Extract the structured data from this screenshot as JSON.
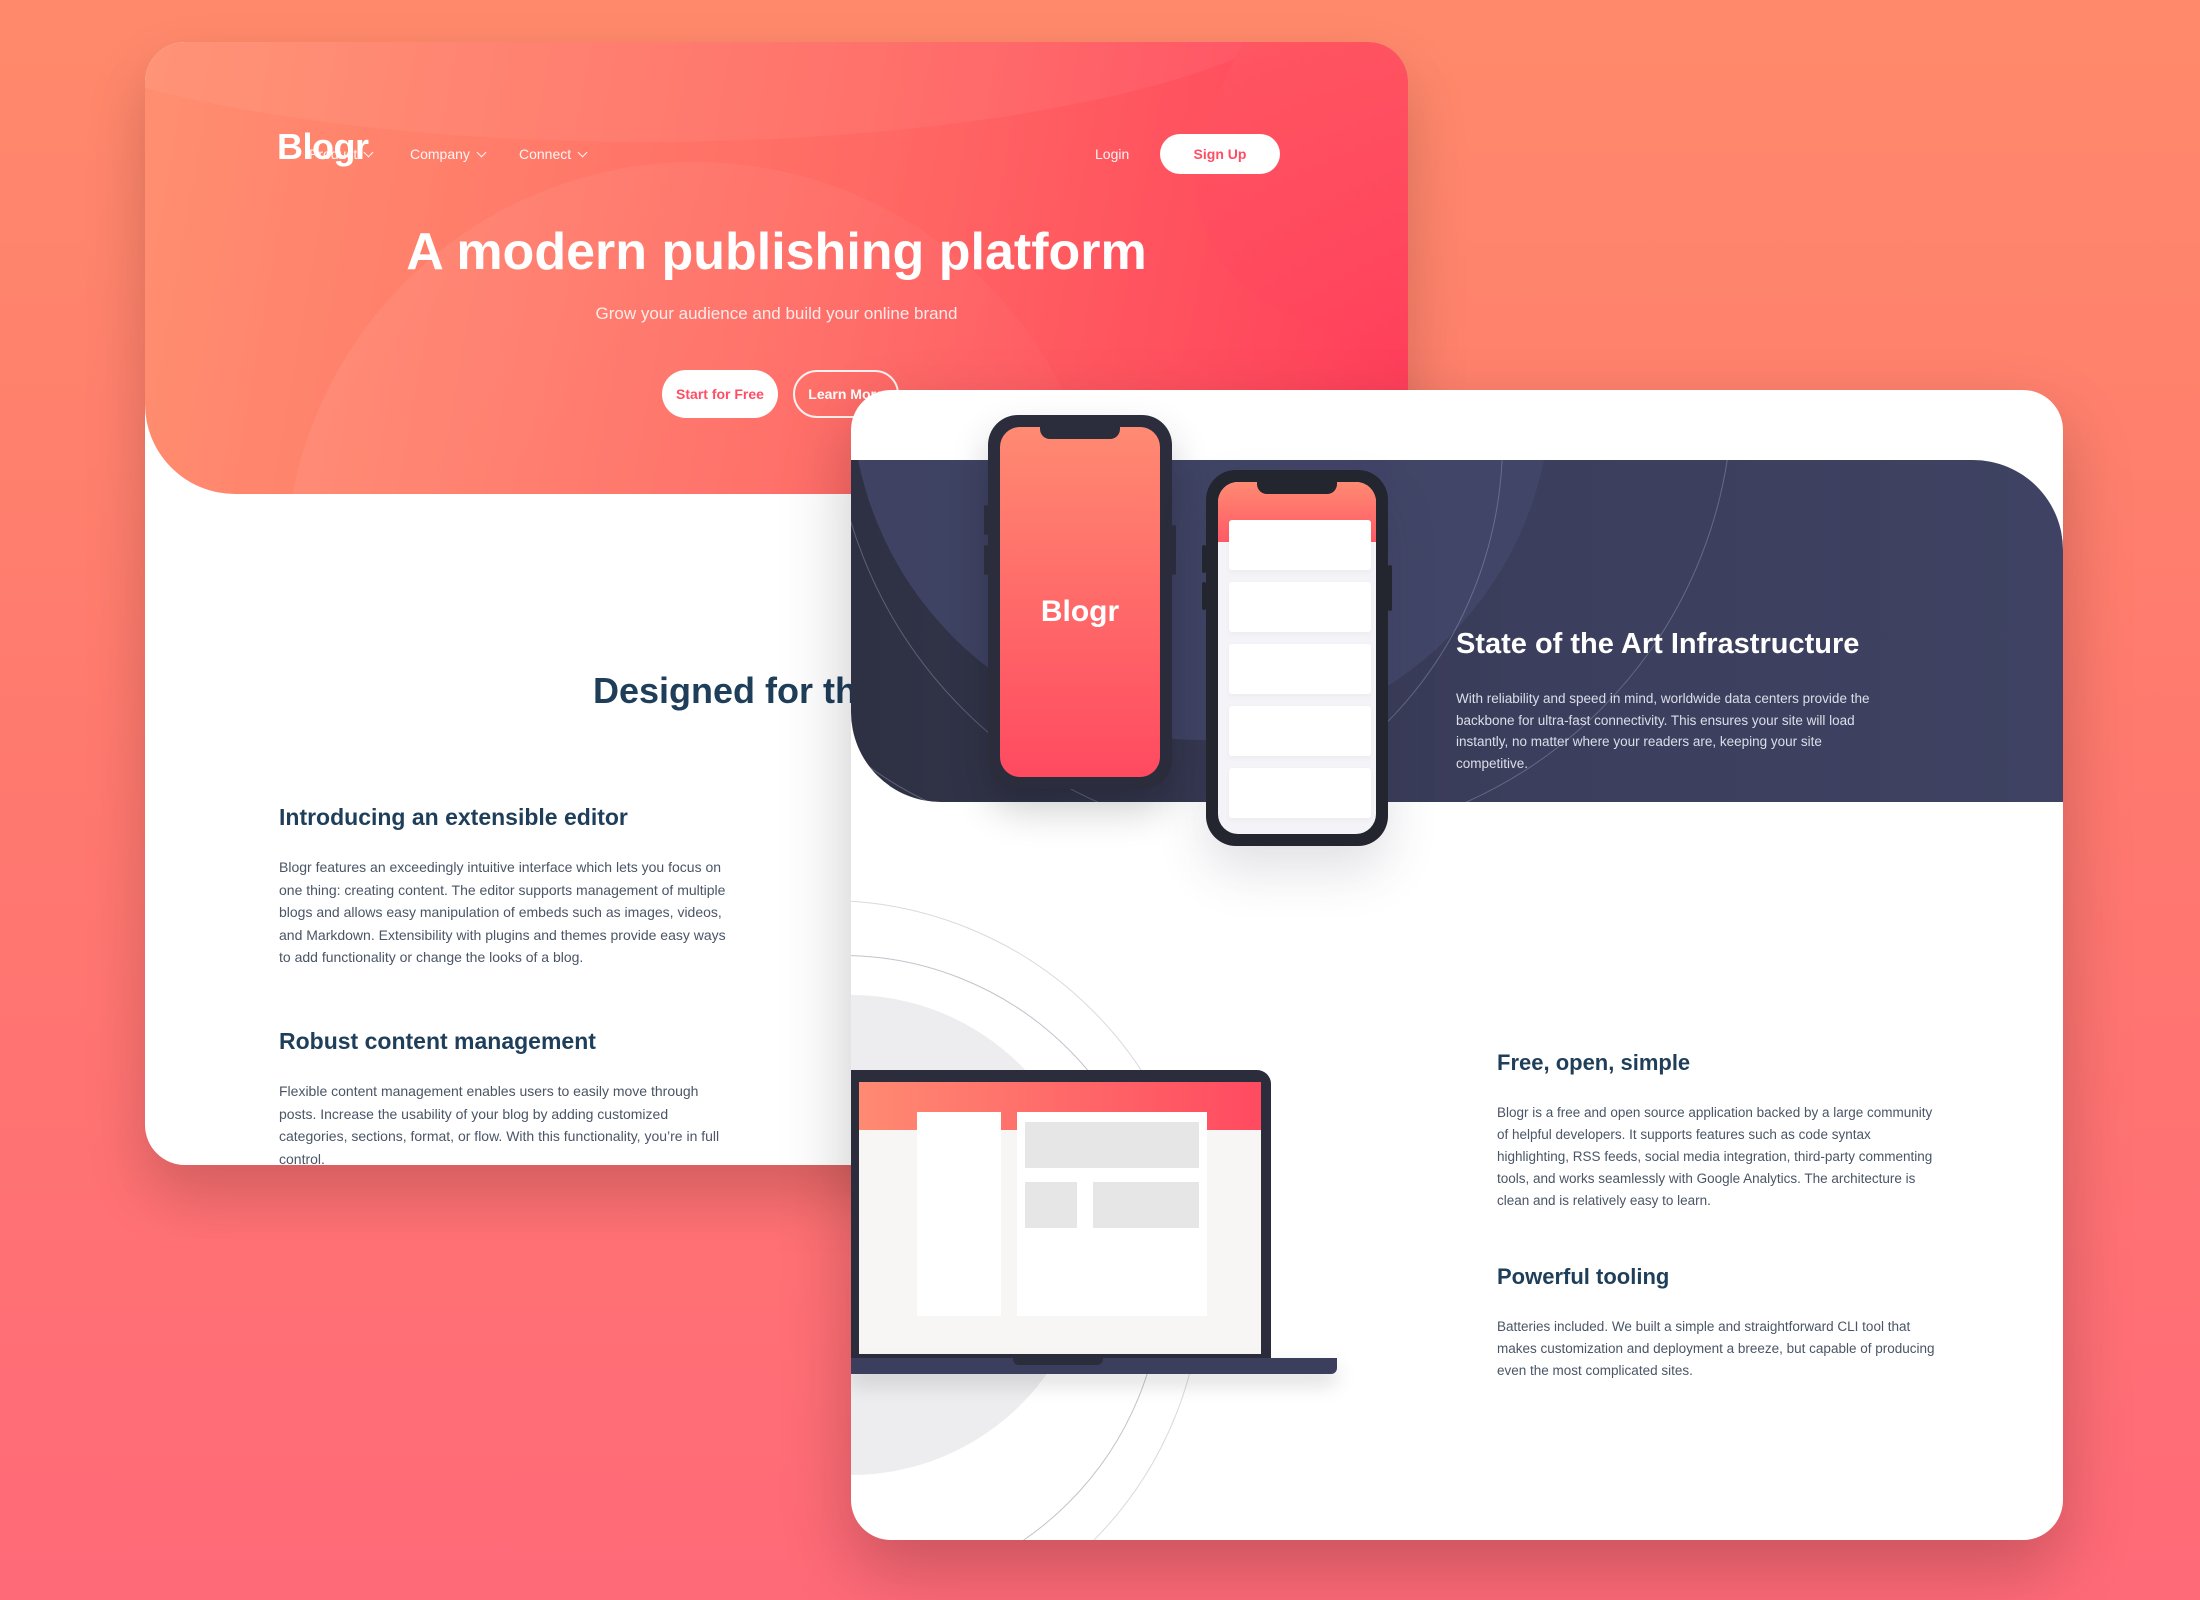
{
  "back_card": {
    "logo": "Blogr",
    "nav": [
      {
        "label": "Product"
      },
      {
        "label": "Company"
      },
      {
        "label": "Connect"
      }
    ],
    "login": "Login",
    "signup": "Sign Up",
    "hero_title": "A modern publishing platform",
    "hero_subtitle": "Grow your audience and build your online brand",
    "cta_primary": "Start for Free",
    "cta_secondary": "Learn More",
    "section_title_visible": "Designed for the",
    "features": [
      {
        "title": "Introducing an extensible editor",
        "body": "Blogr features an exceedingly intuitive interface which lets you focus on one thing: creating content. The editor supports management of multiple blogs and allows easy manipulation of embeds such as images, videos, and Markdown. Extensibility with plugins and themes provide easy ways to add functionality or change the looks of a blog."
      },
      {
        "title": "Robust content management",
        "body": "Flexible content management enables users to easily move through posts. Increase the usability of your blog by adding customized categories, sections, format, or flow. With this functionality, you’re in full control."
      }
    ]
  },
  "front_card": {
    "phone_logo": "Blogr",
    "infra_title": "State of the Art Infrastructure",
    "infra_body": "With reliability and speed in mind, worldwide data centers provide the backbone for ultra-fast connectivity. This ensures your site will load instantly, no matter where your readers are, keeping your site competitive.",
    "features": [
      {
        "title": "Free, open, simple",
        "body": "Blogr is a free and open source application backed by a large community of helpful developers. It supports features such as code syntax highlighting, RSS feeds, social media integration, third-party commenting tools, and works seamlessly with Google Analytics. The architecture is clean and is relatively easy to learn."
      },
      {
        "title": "Powerful tooling",
        "body": "Batteries included. We built a simple and straightforward CLI tool that makes customization and deployment a breeze, but capable of producing even the most complicated sites."
      }
    ]
  },
  "colors": {
    "brand_red": "#ff4e64",
    "heading_navy": "#1f3e5a",
    "infra_bg": "#3b3e5c"
  },
  "icons": [
    "chevron-down-icon"
  ]
}
